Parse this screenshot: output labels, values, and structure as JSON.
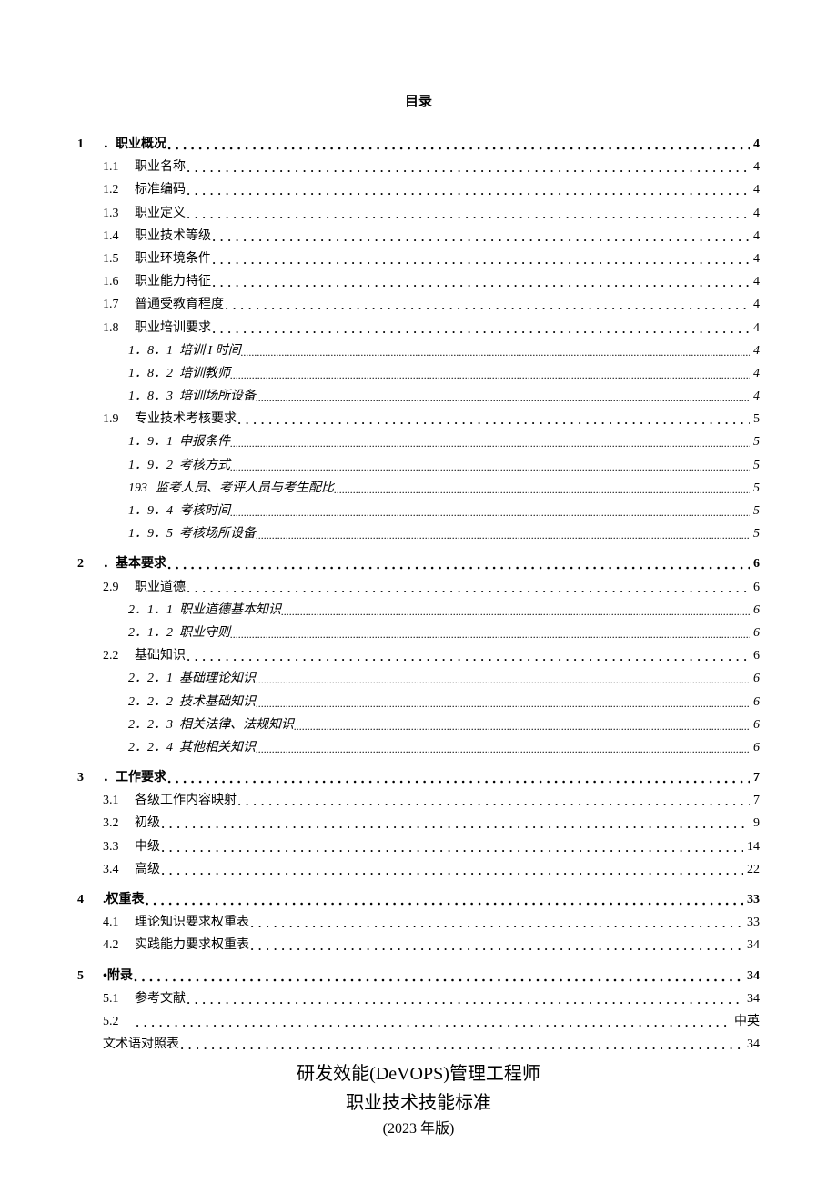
{
  "toc_title": "目录",
  "sections": {
    "s1": {
      "num": "1",
      "label": "．职业概况",
      "page": "4"
    },
    "s1_1": {
      "num": "1.1",
      "label": "职业名称",
      "page": "4"
    },
    "s1_2": {
      "num": "1.2",
      "label": "标准编码",
      "page": "4"
    },
    "s1_3": {
      "num": "1.3",
      "label": "职业定义",
      "page": "4"
    },
    "s1_4": {
      "num": "1.4",
      "label": "职业技术等级",
      "page": "4"
    },
    "s1_5": {
      "num": "1.5",
      "label": "职业环境条件",
      "page": "4"
    },
    "s1_6": {
      "num": "1.6",
      "label": "职业能力特征",
      "page": "4"
    },
    "s1_7": {
      "num": "1.7",
      "label": "普通受教育程度",
      "page": "4"
    },
    "s1_8": {
      "num": "1.8",
      "label": "职业培训要求",
      "page": "4"
    },
    "s1_8_1": {
      "num": "1．8．1",
      "label": "培训 I 时间",
      "page": "4"
    },
    "s1_8_2": {
      "num": "1．8．2",
      "label": "培训教师",
      "page": "4"
    },
    "s1_8_3": {
      "num": "1．8．3",
      "label": "培训场所设备",
      "page": "4"
    },
    "s1_9": {
      "num": "1.9",
      "label": "专业技术考核要求",
      "page": "5"
    },
    "s1_9_1": {
      "num": "1．9．1",
      "label": "申报条件",
      "page": "5"
    },
    "s1_9_2": {
      "num": "1．9．2",
      "label": "考核方式",
      "page": "5"
    },
    "s1_9_3": {
      "num": "193",
      "label": "监考人员、考评人员与考生配比",
      "page": "5"
    },
    "s1_9_4": {
      "num": "1．9．4",
      "label": "考核时间",
      "page": "5"
    },
    "s1_9_5": {
      "num": "1．9．5",
      "label": "考核场所设备",
      "page": "5"
    },
    "s2": {
      "num": "2",
      "label": "．基本要求",
      "page": "6"
    },
    "s2_9": {
      "num": "2.9",
      "label": "职业道德",
      "page": "6"
    },
    "s2_1_1": {
      "num": "2．1．1",
      "label": "职业道德基本知识",
      "page": "6"
    },
    "s2_1_2": {
      "num": "2．1．2",
      "label": "职业守则",
      "page": "6"
    },
    "s2_2": {
      "num": "2.2",
      "label": "基础知识",
      "page": "6"
    },
    "s2_2_1": {
      "num": "2．2．1",
      "label": "基础理论知识",
      "page": "6"
    },
    "s2_2_2": {
      "num": "2．2．2",
      "label": "技术基础知识",
      "page": "6"
    },
    "s2_2_3": {
      "num": "2．2．3",
      "label": "相关法律、法规知识",
      "page": "6"
    },
    "s2_2_4": {
      "num": "2．2．4",
      "label": "其他相关知识",
      "page": "6"
    },
    "s3": {
      "num": "3",
      "label": "．工作要求",
      "page": "7"
    },
    "s3_1": {
      "num": "3.1",
      "label": "各级工作内容映射",
      "page": "7"
    },
    "s3_2": {
      "num": "3.2",
      "label": "初级",
      "page": "9"
    },
    "s3_3": {
      "num": "3.3",
      "label": "中级",
      "page": "14"
    },
    "s3_4": {
      "num": "3.4",
      "label": "高级",
      "page": "22"
    },
    "s4": {
      "num": "4",
      "label": ".权重表",
      "page": "33"
    },
    "s4_1": {
      "num": "4.1",
      "label": "理论知识要求权重表",
      "page": "33"
    },
    "s4_2": {
      "num": "4.2",
      "label": "实践能力要求权重表",
      "page": "34"
    },
    "s5": {
      "num": "5",
      "label": "•附录",
      "page": "34"
    },
    "s5_1": {
      "num": "5.1",
      "label": "参考文献",
      "page": "34"
    },
    "s5_2a": {
      "num": "5.2",
      "label": "",
      "page": "中英"
    },
    "s5_2b": {
      "num": "",
      "label": "文术语对照表",
      "page": "34"
    }
  },
  "footer": {
    "title1": "研发效能(DeVOPS)管理工程师",
    "title2": "职业技术技能标准",
    "year": "(2023 年版)"
  }
}
